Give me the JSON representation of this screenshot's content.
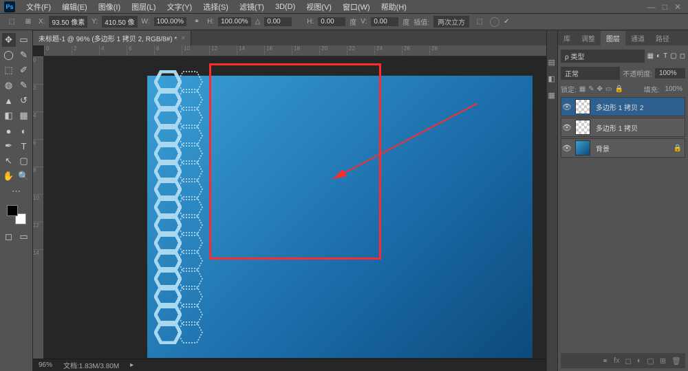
{
  "menubar": {
    "logo": "Ps",
    "items": [
      "文件(F)",
      "编辑(E)",
      "图像(I)",
      "图层(L)",
      "文字(Y)",
      "选择(S)",
      "滤镜(T)",
      "3D(D)",
      "视图(V)",
      "窗口(W)",
      "帮助(H)"
    ]
  },
  "optbar": {
    "x_label": "X:",
    "x_val": "93.50 像素",
    "y_label": "Y:",
    "y_val": "410.50 像",
    "w_label": "W:",
    "w_val": "100.00%",
    "h_label": "H:",
    "h_val": "100.00%",
    "angle_label": "△",
    "angle_val": "0.00",
    "h2_label": "H:",
    "h2_val": "0.00",
    "h2_unit": "度",
    "v_label": "V:",
    "v_val": "0.00",
    "v_unit": "度",
    "interp_label": "插值:",
    "interp_val": "两次立方"
  },
  "document": {
    "tab_title": "未标题-1 @ 96% (多边形 1 拷贝 2, RGB/8#) *"
  },
  "ruler_h": [
    "0",
    "2",
    "4",
    "6",
    "8",
    "10",
    "12",
    "14",
    "16",
    "18",
    "20",
    "22",
    "24",
    "26",
    "28"
  ],
  "ruler_v": [
    "0",
    "2",
    "4",
    "6",
    "8",
    "10",
    "12",
    "14"
  ],
  "statusbar": {
    "zoom": "96%",
    "docinfo": "文档:1.83M/3.80M"
  },
  "panels": {
    "tabs_row1": [
      "库",
      "调整",
      "图层",
      "通道",
      "路径"
    ],
    "kind_label": "ρ 类型",
    "blend_mode": "正常",
    "opacity_label": "不透明度:",
    "opacity_val": "100%",
    "lock_label": "锁定:",
    "fill_label": "填充:",
    "fill_val": "100%",
    "layers": [
      {
        "name": "多边形 1 拷贝 2",
        "visible": true,
        "active": true,
        "thumb": "checker"
      },
      {
        "name": "多边形 1 拷贝",
        "visible": true,
        "active": false,
        "thumb": "checker"
      },
      {
        "name": "背景",
        "visible": true,
        "active": false,
        "thumb": "grad",
        "locked": true
      }
    ]
  }
}
